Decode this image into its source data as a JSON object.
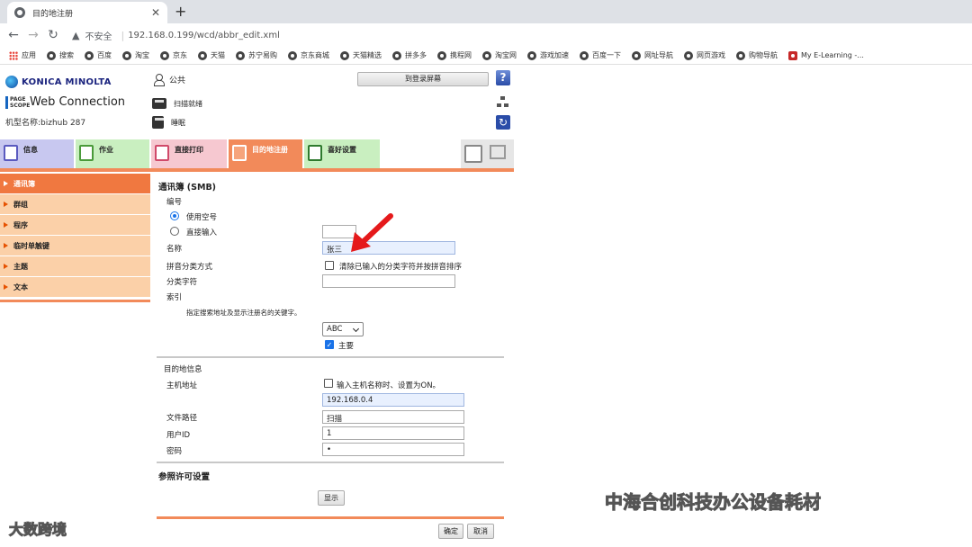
{
  "browser": {
    "tab_title": "目的地注册",
    "tab_close": "✕",
    "new_tab": "+",
    "insecure_label": "不安全",
    "url": "192.168.0.199/wcd/abbr_edit.xml",
    "bookmarks": [
      "应用",
      "搜索",
      "百度",
      "淘宝",
      "京东",
      "天猫",
      "苏宁易购",
      "京东商城",
      "天猫精选",
      "拼多多",
      "携程网",
      "淘宝网",
      "游戏加速",
      "百度一下",
      "网址导航",
      "网页游戏",
      "购物导航",
      "My E-Learning -..."
    ]
  },
  "header": {
    "brand": "KONICA MINOLTA",
    "product_small": "PAGE SCOPE",
    "product": "Web Connection",
    "model": "机型名称:bizhub 287",
    "user": "公共",
    "login_button": "到登录屏幕",
    "help": "?",
    "scan_status": "扫描就绪",
    "printer_status": "睡眠"
  },
  "tabs": {
    "info": "信息",
    "job": "作业",
    "print": "直接打印",
    "dest": "目的地注册",
    "pref": "喜好设置"
  },
  "leftmenu": [
    "通讯簿",
    "群组",
    "程序",
    "临时单触键",
    "主题",
    "文本"
  ],
  "form": {
    "title": "通讯簿 (SMB)",
    "number_label": "编号",
    "use_free_number": "使用空号",
    "direct_input": "直接输入",
    "name_label": "名称",
    "name_value": "张三",
    "pinyin_label": "拼音分类方式",
    "pinyin_check_label": "清除已输入的分类字符并按拼音排序",
    "sort_char_label": "分类字符",
    "index_label": "索引",
    "index_note": "指定搜索地址及显示注册名的关键字。",
    "index_select": "ABC",
    "main_label": "主要",
    "dest_info": "目的地信息",
    "host_label": "主机地址",
    "host_check_label": "输入主机名称时、设置为ON。",
    "host_value": "192.168.0.4",
    "path_label": "文件路径",
    "path_value": "扫描",
    "userid_label": "用户ID",
    "userid_value": "1",
    "password_label": "密码",
    "password_value": "•",
    "ref_perm": "参照许可设置",
    "display_button": "显示",
    "ok_button": "确定",
    "cancel_button": "取消"
  },
  "watermarks": {
    "right": "中海合创科技办公设备耗材",
    "left": "大数跨境"
  }
}
